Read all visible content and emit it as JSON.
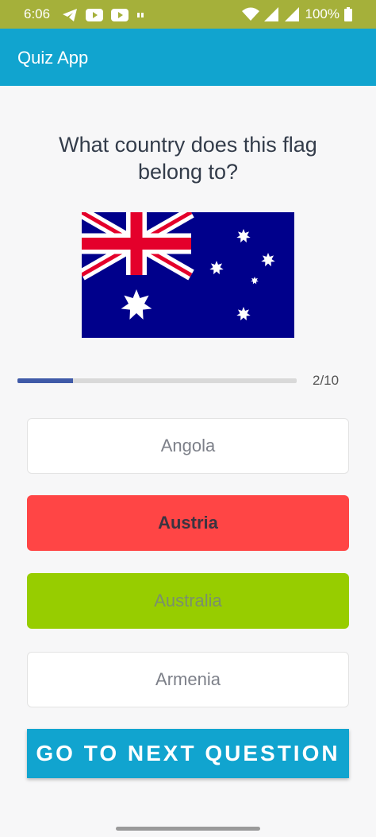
{
  "status_bar": {
    "time": "6:06",
    "battery": "100%",
    "icons": [
      "telegram-icon",
      "youtube-icon",
      "youtube-icon",
      "data-24-icon",
      "wifi-icon",
      "signal-icon",
      "signal-icon",
      "battery-icon"
    ],
    "background": "#a5b03a"
  },
  "app_bar": {
    "title": "Quiz App",
    "background": "#11a4cf"
  },
  "question": {
    "text": "What country does this flag belong to?"
  },
  "flag": {
    "country": "Australia",
    "icon": "australia-flag"
  },
  "progress": {
    "current": 2,
    "total": 10,
    "label": "2/10",
    "fill_color": "#3f5aa8"
  },
  "options": [
    {
      "label": "Angola",
      "state": "default"
    },
    {
      "label": "Austria",
      "state": "wrong",
      "color": "#ff4545"
    },
    {
      "label": "Australia",
      "state": "correct",
      "color": "#97cd00"
    },
    {
      "label": "Armenia",
      "state": "default"
    }
  ],
  "next_button": {
    "label": "GO TO NEXT QUESTION"
  }
}
